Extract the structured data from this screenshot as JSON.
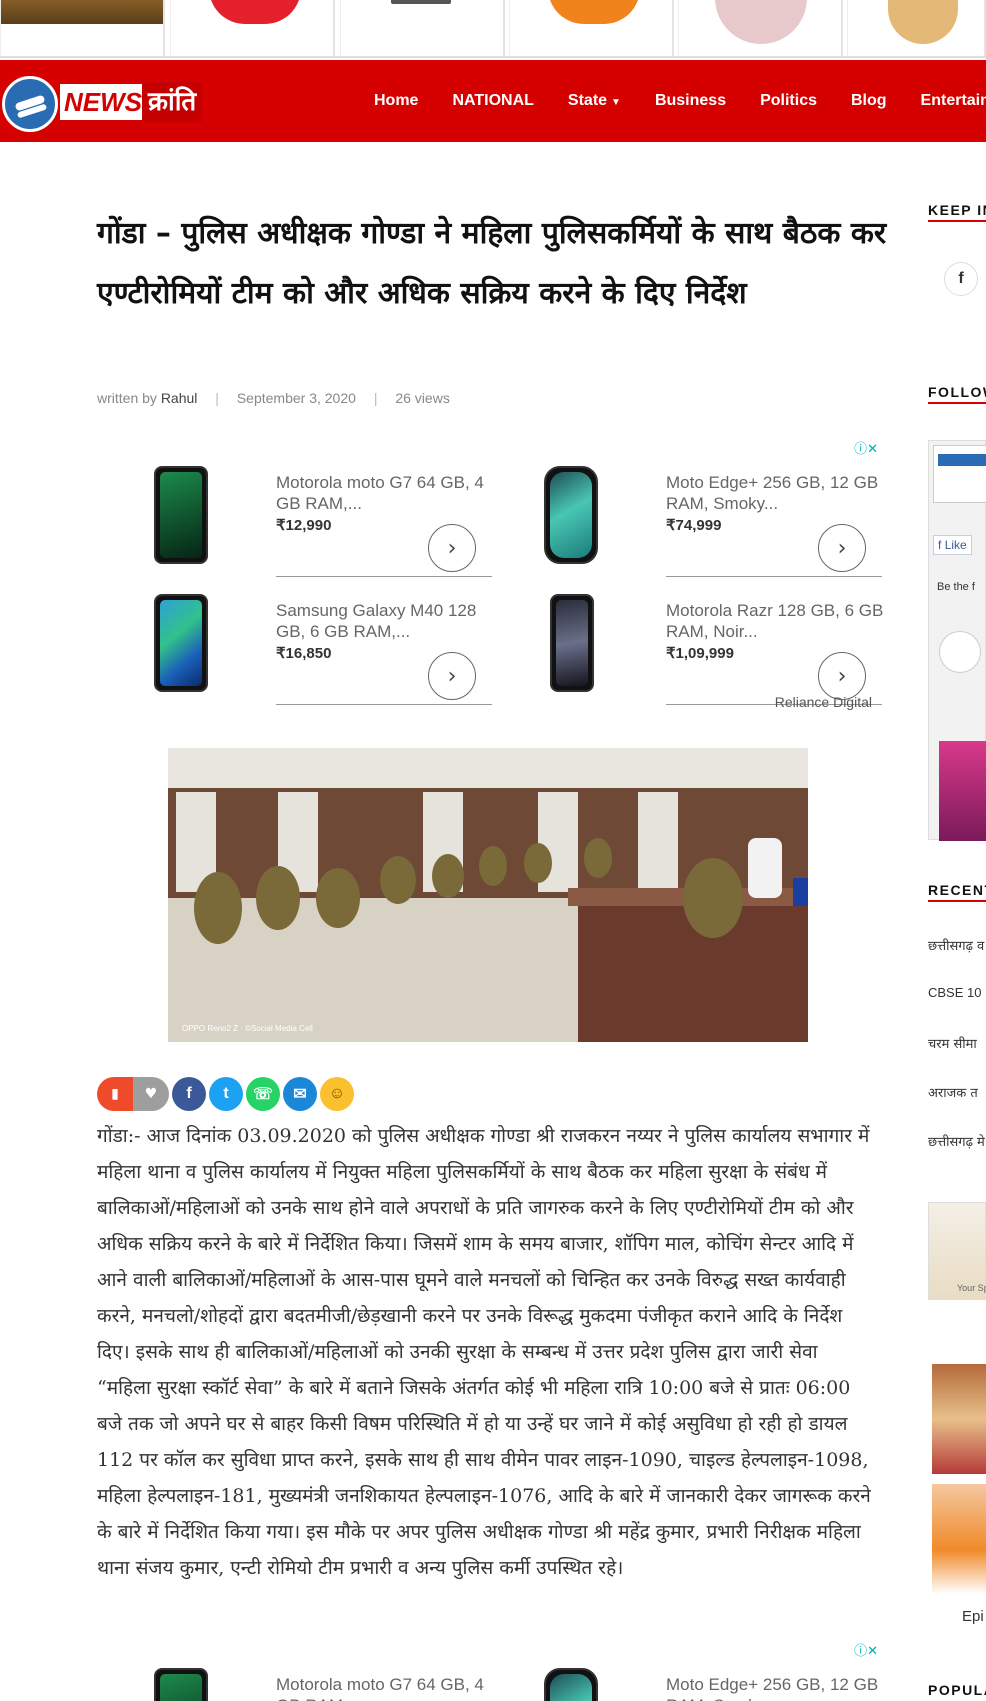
{
  "colors": {
    "brand_red": "#d50000",
    "facebook": "#3b5998",
    "twitter": "#1da1f2",
    "whatsapp": "#25d366",
    "email": "#1a87d8"
  },
  "logo": {
    "news": "NEWS",
    "kranti": "क्रांति"
  },
  "nav": {
    "items": [
      "Home",
      "NATIONAL",
      "State",
      "Business",
      "Politics",
      "Blog",
      "Entertainment"
    ]
  },
  "article": {
    "title": "गोंडा – पुलिस अधीक्षक गोण्डा ने महिला पुलिसकर्मियों के साथ बैठक कर एण्टीरोमियों टीम को और अधिक सक्रिय करने के दिए निर्देश",
    "meta": {
      "written_by": "written by",
      "author": "Rahul",
      "date": "September 3, 2020",
      "views": "26 views"
    },
    "photo_caption": "OPPO Reno2 Z · ©Social Media Cell",
    "body": "गोंडा:- आज दिनांक 03.09.2020 को पुलिस अधीक्षक गोण्डा श्री राजकरन नय्यर ने पुलिस कार्यालय सभागार में महिला थाना व पुलिस कार्यालय में नियुक्त महिला पुलिसकर्मियों के साथ बैठक कर महिला सुरक्षा के संबंध में बालिकाओं/महिलाओं को उनके साथ होने वाले अपराधों के प्रति जागरुक करने के लिए एण्टीरोमियों टीम को और अधिक सक्रिय करने के बारे में निर्देशित किया। जिसमें शाम के समय बाजार, शॉपिग माल, कोचिंग सेन्टर आदि में आने वाली बालिकाओं/महिलाओं के  आस-पास घूमने वाले मनचलों को चिन्हित कर उनके विरुद्ध सख्त कार्यवाही करने, मनचलो/शोहदों द्वारा बदतमीजी/छेड़खानी करने पर उनके विरूद्ध मुकदमा पंजीकृत कराने आदि के निर्देश दिए। इसके साथ ही बालिकाओं/महिलाओं को उनकी सुरक्षा के सम्बन्ध में उत्तर प्रदेश पुलिस द्वारा जारी सेवा “महिला सुरक्षा स्कॉर्ट सेवा” के बारे में बताने जिसके अंतर्गत कोई भी महिला रात्रि 10:00 बजे से प्रातः 06:00 बजे तक जो अपने घर से बाहर किसी विषम परिस्थिति में हो या उन्हें घर जाने में कोई असुविधा हो रही हो डायल 112 पर कॉल कर सुविधा प्राप्त करने, इसके साथ ही साथ वीमेन पावर लाइन-1090, चाइल्ड हेल्पलाइन-1098, महिला हेल्पलाइन-181, मुख्यमंत्री जनशिकायत हेल्पलाइन-1076, आदि के बारे में जानकारी देकर जागरूक करने के बारे में निर्देशित किया गया। इस मौके पर अपर पुलिस अधीक्षक गोण्डा श्री महेंद्र कुमार, प्रभारी निरीक्षक महिला थाना संजय कुमार, एन्टी रोमियो टीम प्रभारी व अन्य पुलिस कर्मी उपस्थित रहे।"
  },
  "ads": {
    "source": "Reliance Digital",
    "items": [
      {
        "name": "Motorola moto G7 64 GB, 4 GB RAM,...",
        "price": "₹12,990"
      },
      {
        "name": "Moto Edge+ 256 GB, 12 GB RAM, Smoky...",
        "price": "₹74,999"
      },
      {
        "name": "Samsung Galaxy M40 128 GB, 6 GB RAM,...",
        "price": "₹16,850"
      },
      {
        "name": "Motorola Razr 128 GB, 6 GB RAM, Noir...",
        "price": "₹1,09,999"
      }
    ]
  },
  "sidebar": {
    "keep_in_touch": "KEEP IN",
    "follow": "FOLLOW",
    "like_label": "Like",
    "be_first": "Be the f",
    "recent": "RECENT",
    "recent_items": [
      "छत्तीसगढ़ व",
      "CBSE 10",
      "चरम सीमा",
      "अराजक त",
      "छत्तीसगढ़ मे"
    ],
    "your_sp": "Your Sp",
    "epi": "Epi",
    "popular": "POPULA"
  }
}
